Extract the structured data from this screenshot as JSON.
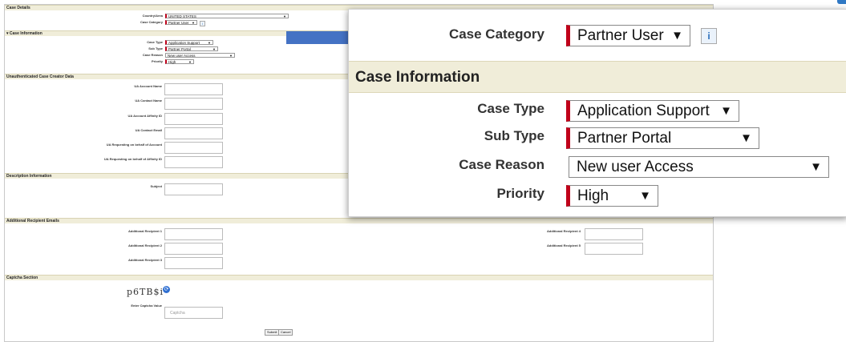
{
  "case_details": {
    "title": "Case Details",
    "country_label": "Country/Area",
    "country_value": "UNITED STATES",
    "category_label": "Case Category",
    "category_value": "Partner User"
  },
  "case_info": {
    "title": "Case Information",
    "type_label": "Case Type",
    "type_value": "Application Support",
    "subtype_label": "Sub Type",
    "subtype_value": "Partner Portal",
    "reason_label": "Case Reason",
    "reason_value": "New user Access",
    "priority_label": "Priority",
    "priority_value": "High"
  },
  "unauth": {
    "title": "Unauthenticated Case Creator Data",
    "fields": [
      "UA Account Name",
      "UA Contact Name",
      "UA Account Affinity ID",
      "UA Contact Email",
      "UA Requesting on behalf of Account",
      "UA Requesting on behalf of Affinity ID"
    ]
  },
  "description": {
    "title": "Description Information",
    "subject_label": "Subject"
  },
  "recipients": {
    "title": "Additional Recipient Emails",
    "left": [
      "Additional Recipient 1",
      "Additional Recipient 2",
      "Additional Recipient 3"
    ],
    "right": [
      "Additional Recipient 4",
      "Additional Recipient 5"
    ]
  },
  "captcha": {
    "title": "Captcha Section",
    "text": "p6TB$i",
    "enter_label": "Enter Captcha Value",
    "placeholder": "Captcha"
  },
  "buttons": {
    "submit": "Submit",
    "cancel": "Cancel"
  },
  "icons": {
    "dropdown": "▼",
    "info": "i",
    "refresh": "⟳",
    "collapse": "▾"
  },
  "colors": {
    "section_bg": "#f0edd9",
    "required": "#c0001a",
    "arrow": "#4472c4",
    "accent": "#2f6fd1"
  }
}
